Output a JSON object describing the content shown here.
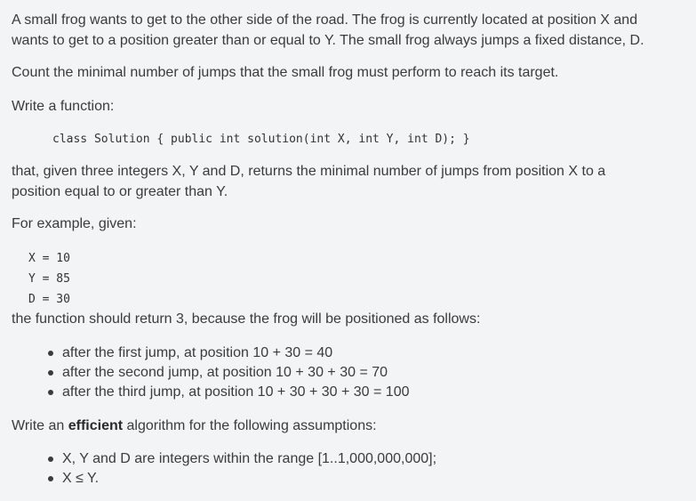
{
  "intro": {
    "line1": "A small frog wants to get to the other side of the road. The frog is currently located at position X and",
    "line2": "wants to get to a position greater than or equal to Y. The small frog always jumps a fixed distance, D."
  },
  "count_text": "Count the minimal number of jumps that the small frog must perform to reach its target.",
  "write_function": "Write a function:",
  "signature": "class Solution { public int solution(int X, int Y, int D); }",
  "that_given": {
    "line1": "that, given three integers X, Y and D, returns the minimal number of jumps from position X to a",
    "line2": "position equal to or greater than Y."
  },
  "for_example": "For example, given:",
  "example_values": [
    "X = 10",
    "Y = 85",
    "D = 30"
  ],
  "return_text": "the function should return 3, because the frog will be positioned as follows:",
  "jumps": [
    "after the first jump, at position 10 + 30 = 40",
    "after the second jump, at position 10 + 30 + 30 = 70",
    "after the third jump, at position 10 + 30 + 30 + 30 = 100"
  ],
  "efficient": {
    "prefix": "Write an ",
    "bold": "efficient",
    "suffix": " algorithm for the following assumptions:"
  },
  "assumptions": [
    "X, Y and D are integers within the range [1..1,000,000,000];",
    "X ≤ Y."
  ]
}
